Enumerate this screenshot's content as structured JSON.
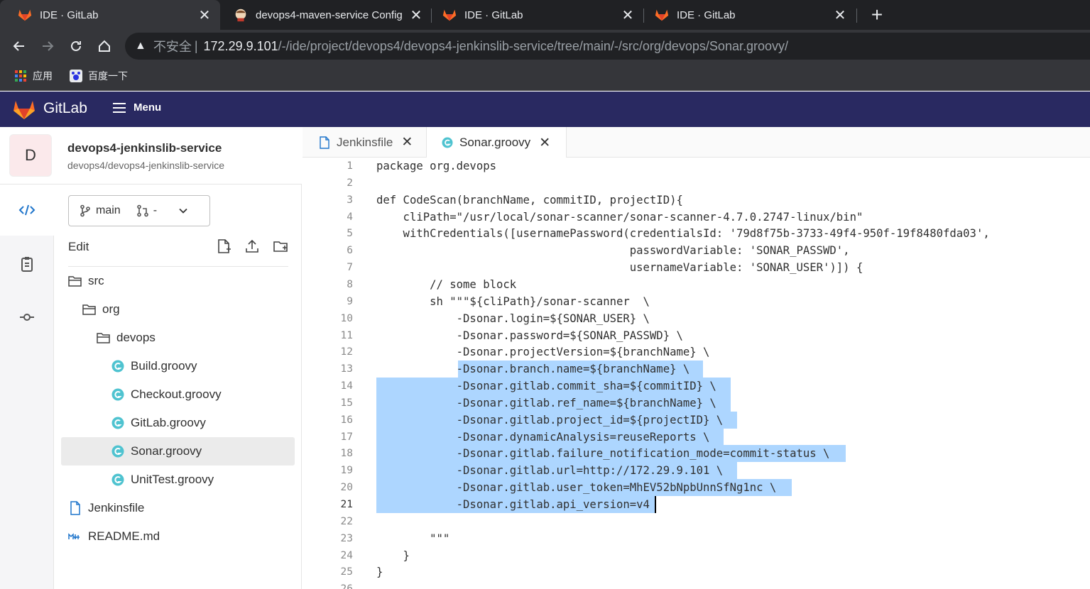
{
  "browser": {
    "tabs": [
      {
        "title": "IDE · GitLab",
        "icon": "gitlab-fox-icon"
      },
      {
        "title": "devops4-maven-service Config",
        "icon": "jenkins-icon"
      },
      {
        "title": "IDE · GitLab",
        "icon": "gitlab-fox-icon"
      },
      {
        "title": "IDE · GitLab",
        "icon": "gitlab-fox-icon"
      }
    ],
    "close_glyph": "✕",
    "new_tab_glyph": "+",
    "address": {
      "security_label": "不安全",
      "separator": "|",
      "host": "172.29.9.101",
      "path": "/-/ide/project/devops4/devops4-jenkinslib-service/tree/main/-/src/org/devops/Sonar.groovy/"
    },
    "bookmarks": [
      {
        "label": "应用",
        "icon": "apps-grid-icon"
      },
      {
        "label": "百度一下",
        "icon": "baidu-paw-icon"
      }
    ]
  },
  "gitlab": {
    "brand": "GitLab",
    "menu_label": "Menu",
    "colors": {
      "header": "#292961",
      "selection": "#add6ff"
    }
  },
  "project": {
    "avatar_letter": "D",
    "name": "devops4-jenkinslib-service",
    "path": "devops4/devops4-jenkinslib-service"
  },
  "branch": {
    "name": "main",
    "mr": "-"
  },
  "tree": {
    "edit_label": "Edit",
    "items": [
      {
        "label": "src",
        "type": "folder"
      },
      {
        "label": "org",
        "type": "folder"
      },
      {
        "label": "devops",
        "type": "folder"
      },
      {
        "label": "Build.groovy",
        "type": "groovy"
      },
      {
        "label": "Checkout.groovy",
        "type": "groovy"
      },
      {
        "label": "GitLab.groovy",
        "type": "groovy"
      },
      {
        "label": "Sonar.groovy",
        "type": "groovy",
        "selected": true
      },
      {
        "label": "UnitTest.groovy",
        "type": "groovy"
      },
      {
        "label": "Jenkinsfile",
        "type": "file"
      },
      {
        "label": "README.md",
        "type": "markdown"
      }
    ]
  },
  "editor": {
    "tabs": [
      {
        "label": "Jenkinsfile",
        "icon": "file-icon"
      },
      {
        "label": "Sonar.groovy",
        "icon": "groovy-icon",
        "active": true
      }
    ],
    "close_glyph": "✕",
    "current_line": 21,
    "lines": [
      "package org.devops",
      "",
      "def CodeScan(branchName, commitID, projectID){",
      "    cliPath=\"/usr/local/sonar-scanner/sonar-scanner-4.7.0.2747-linux/bin\"",
      "    withCredentials([usernamePassword(credentialsId: '79d8f75b-3733-49f4-950f-19f8480fda03',",
      "                                      passwordVariable: 'SONAR_PASSWD',",
      "                                      usernameVariable: 'SONAR_USER')]) {",
      "        // some block",
      "        sh \"\"\"${cliPath}/sonar-scanner  \\",
      "            -Dsonar.login=${SONAR_USER} \\",
      "            -Dsonar.password=${SONAR_PASSWD} \\",
      "            -Dsonar.projectVersion=${branchName} \\",
      "            -Dsonar.branch.name=${branchName} \\",
      "            -Dsonar.gitlab.commit_sha=${commitID} \\",
      "            -Dsonar.gitlab.ref_name=${branchName} \\",
      "            -Dsonar.gitlab.project_id=${projectID} \\",
      "            -Dsonar.dynamicAnalysis=reuseReports \\",
      "            -Dsonar.gitlab.failure_notification_mode=commit-status \\",
      "            -Dsonar.gitlab.url=http://172.29.9.101 \\",
      "            -Dsonar.gitlab.user_token=MhEV52bNpbUnnSfNg1nc \\",
      "            -Dsonar.gitlab.api_version=v4",
      "",
      "        \"\"\"",
      "    }",
      "}",
      ""
    ]
  }
}
